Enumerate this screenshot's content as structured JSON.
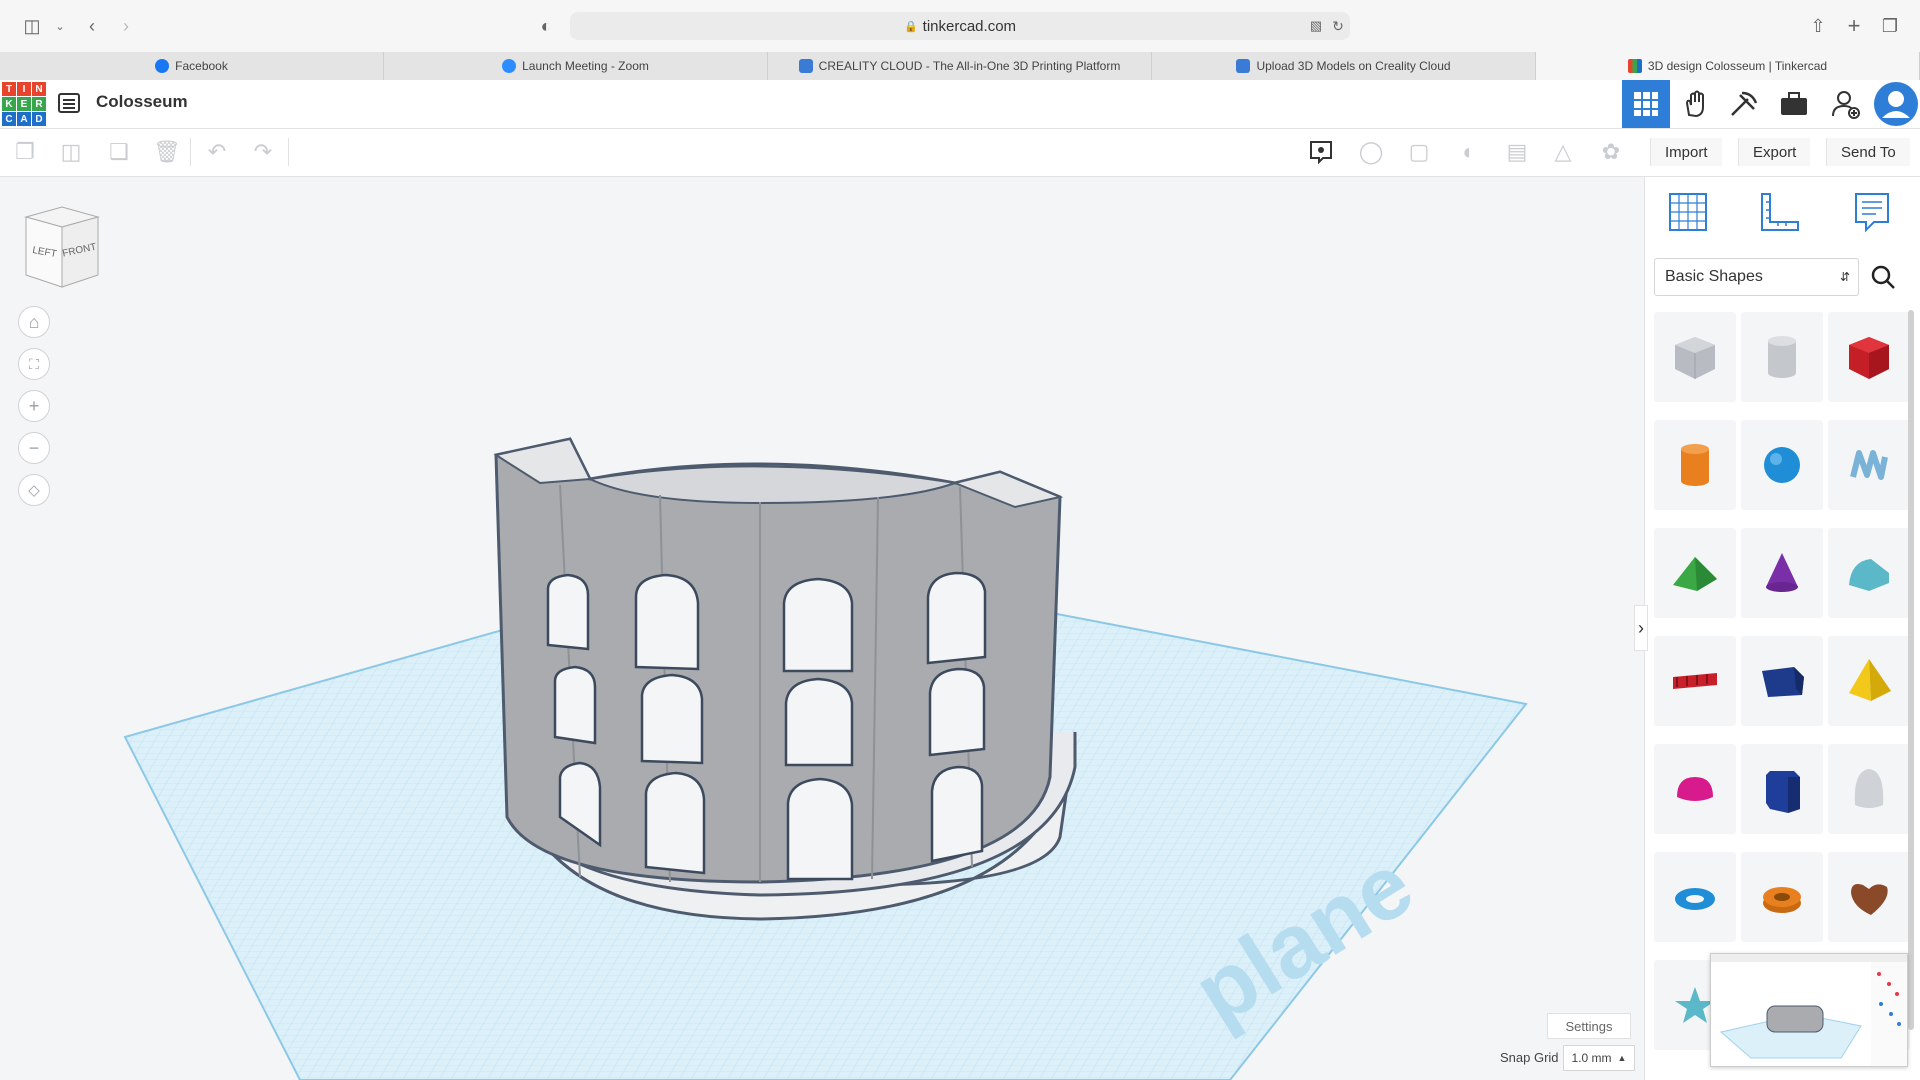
{
  "browser": {
    "url": "tinkercad.com",
    "tabs": [
      {
        "label": "Facebook",
        "color": "#1877f2"
      },
      {
        "label": "Launch Meeting - Zoom",
        "color": "#2d8cff"
      },
      {
        "label": "CREALITY CLOUD - The All-in-One 3D Printing Platform",
        "color": "#3a7bd5"
      },
      {
        "label": "Upload 3D Models on Creality Cloud",
        "color": "#3a7bd5"
      },
      {
        "label": "3D design Colosseum | Tinkercad",
        "color": "#e8442d"
      }
    ]
  },
  "app": {
    "logo_letters": [
      "T",
      "I",
      "N",
      "K",
      "E",
      "R",
      "C",
      "A",
      "D"
    ],
    "design_title": "Colosseum"
  },
  "toolbar": {
    "import_label": "Import",
    "export_label": "Export",
    "send_to_label": "Send To"
  },
  "viewcube": {
    "left": "LEFT",
    "front": "FRONT"
  },
  "workplane": {
    "watermark": "plane"
  },
  "sidebar": {
    "category": "Basic Shapes",
    "shapes": [
      {
        "name": "box-hole",
        "color": "#b8bcc2"
      },
      {
        "name": "cylinder-hole",
        "color": "#c4c7cc"
      },
      {
        "name": "box",
        "color": "#d8222c"
      },
      {
        "name": "cylinder",
        "color": "#e8801f"
      },
      {
        "name": "sphere",
        "color": "#1f8ed6"
      },
      {
        "name": "scribble",
        "color": "#7ab2d8"
      },
      {
        "name": "roof",
        "color": "#3aa844"
      },
      {
        "name": "cone",
        "color": "#7a2fa8"
      },
      {
        "name": "round-roof",
        "color": "#5ab8c8"
      },
      {
        "name": "text",
        "color": "#c8202a"
      },
      {
        "name": "wedge",
        "color": "#1e3a8a"
      },
      {
        "name": "pyramid",
        "color": "#f2c81a"
      },
      {
        "name": "half-sphere",
        "color": "#d81b8c"
      },
      {
        "name": "polygon",
        "color": "#1f3e9a"
      },
      {
        "name": "paraboloid",
        "color": "#cfd2d6"
      },
      {
        "name": "torus",
        "color": "#1f8ed6"
      },
      {
        "name": "tube",
        "color": "#e8801f"
      },
      {
        "name": "heart",
        "color": "#8a4a2a"
      }
    ]
  },
  "footer": {
    "settings_label": "Settings",
    "snap_grid_label": "Snap Grid",
    "snap_grid_value": "1.0 mm"
  }
}
